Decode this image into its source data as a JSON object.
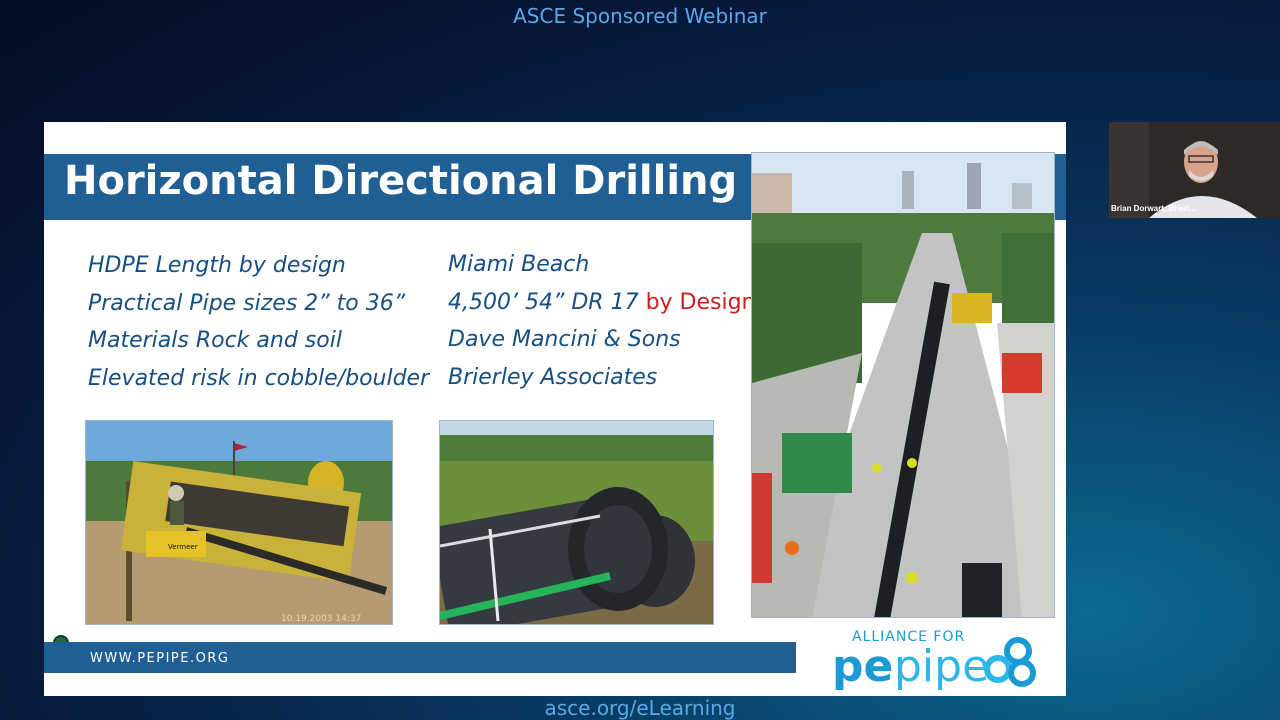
{
  "header": {
    "title": "ASCE Sponsored Webinar"
  },
  "footer": {
    "url": "asce.org/eLearning"
  },
  "slide": {
    "title": "Horizontal Directional Drilling",
    "left_bullets": [
      "HDPE Length by design",
      "Practical Pipe sizes 2” to 36”",
      "Materials Rock and soil",
      "Elevated risk in cobble/boulder"
    ],
    "right_bullets": {
      "line1": "Miami Beach",
      "line2_main": "4,500’ 54” DR 17 ",
      "line2_highlight": "by Design",
      "line3": "Dave Mancini & Sons",
      "line4": "Brierley Associates"
    },
    "footer_url": "WWW.PEPIPE.ORG",
    "photo1_stamp": "10.19.2003 14:37",
    "photo1_brand": "Vermeer",
    "logo": {
      "top": "ALLIANCE FOR",
      "pe": "pe",
      "pipe": "pipe"
    },
    "colors": {
      "title_bar": "#1f5f93",
      "bullet_text": "#164f82",
      "highlight": "#cc1f1f"
    }
  },
  "participant": {
    "name": "Brian Dorwart, Brierl..."
  }
}
